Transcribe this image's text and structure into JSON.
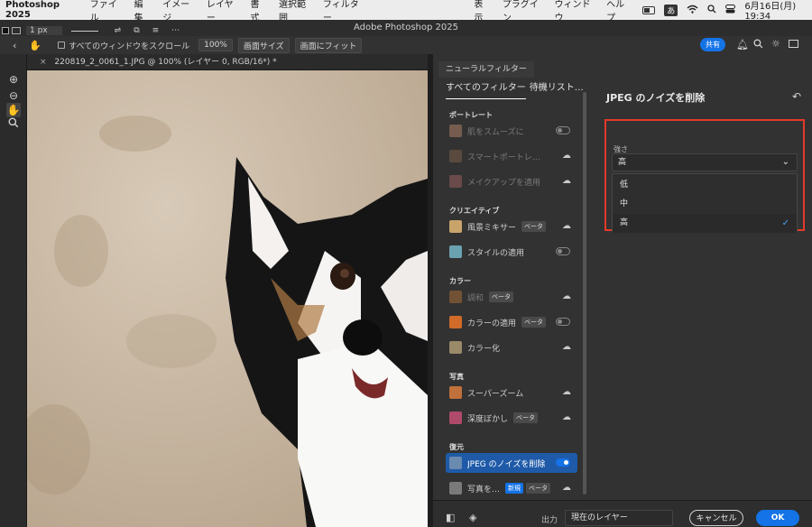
{
  "menubar": {
    "app": "Photoshop 2025",
    "items": [
      "ファイル",
      "編集",
      "イメージ",
      "レイヤー",
      "書式",
      "選択範囲",
      "フィルター",
      "表示",
      "プラグイン",
      "ウィンドウ",
      "ヘルプ"
    ],
    "ime": "あ",
    "clock": "6月16日(月)  19:34"
  },
  "titlebar": {
    "title": "Adobe Photoshop 2025"
  },
  "options": {
    "brush_size": "1 px",
    "scroll_all": "すべてのウィンドウをスクロール",
    "zoom": "100%",
    "fit_screen": "画面サイズ",
    "fill_screen": "画面にフィット",
    "share": "共有"
  },
  "document": {
    "tab": "220819_2_0061_1.JPG @ 100% (レイヤー 0, RGB/16*) *"
  },
  "neural": {
    "panel_tab": "ニューラルフィルター",
    "tab_all": "すべてのフィルター",
    "tab_wait": "待機リスト…",
    "categories": {
      "portrait": "ポートレート",
      "creative": "クリエイティブ",
      "color": "カラー",
      "photo": "写真",
      "restore": "復元"
    },
    "filters": {
      "skin": "肌をスムーズに",
      "smart": "スマートポートレ…",
      "makeup": "メイクアップを適用",
      "landscape": "風景ミキサー",
      "style": "スタイルの適用",
      "harmony": "調和",
      "colorapply": "カラーの適用",
      "colorize": "カラー化",
      "superzoom": "スーパーズーム",
      "depth": "深度ぼかし",
      "jpeg": "JPEG のノイズを削除",
      "photo_restore": "写真を…"
    },
    "beta": "ベータ",
    "new": "新規"
  },
  "settings": {
    "title": "JPEG のノイズを削除",
    "strength_label": "強さ",
    "strength_value": "高",
    "options": [
      "低",
      "中",
      "高"
    ],
    "selected_index": 2
  },
  "footer": {
    "output_label": "出力",
    "output_value": "現在のレイヤー",
    "cancel": "キャンセル",
    "ok": "OK"
  },
  "colors": {
    "accent": "#1473e6",
    "highlight_box": "#e53a2a",
    "panel_bg": "#323232"
  }
}
